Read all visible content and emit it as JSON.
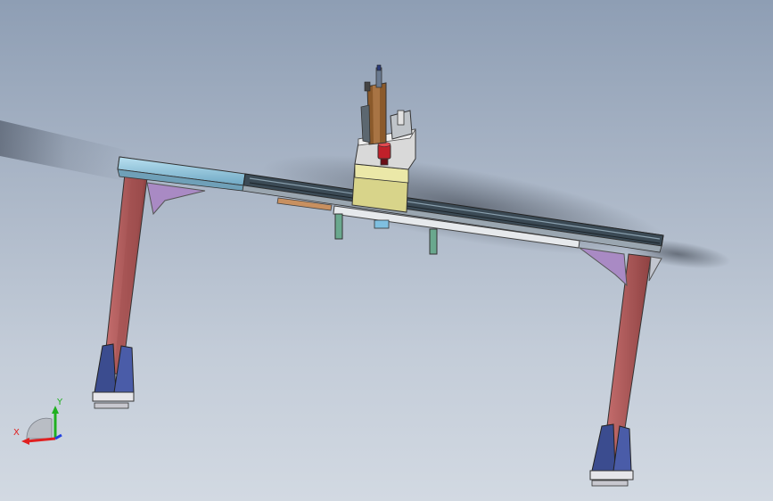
{
  "viewport": {
    "background_top": "#8e9eb4",
    "background_bottom": "#d2d9e2"
  },
  "model": {
    "beam_color": "#8fc4dc",
    "rail_color": "#3b4a55",
    "leg_color": "#b35a5a",
    "gusset_color": "#a98ac4",
    "foot_color": "#3b4c8f",
    "carriage_top_color": "#d9d9d9",
    "carriage_body_color": "#d8d48a",
    "cylinder_color": "#8b5a2b",
    "nozzle_color": "#c0202a",
    "bracket_color": "#6aa88e"
  },
  "triad": {
    "x_label": "X",
    "y_label": "Y",
    "x_color": "#e02020",
    "y_color": "#20b020",
    "z_color": "#2040e0",
    "icon": "coordinate-triad-icon"
  }
}
